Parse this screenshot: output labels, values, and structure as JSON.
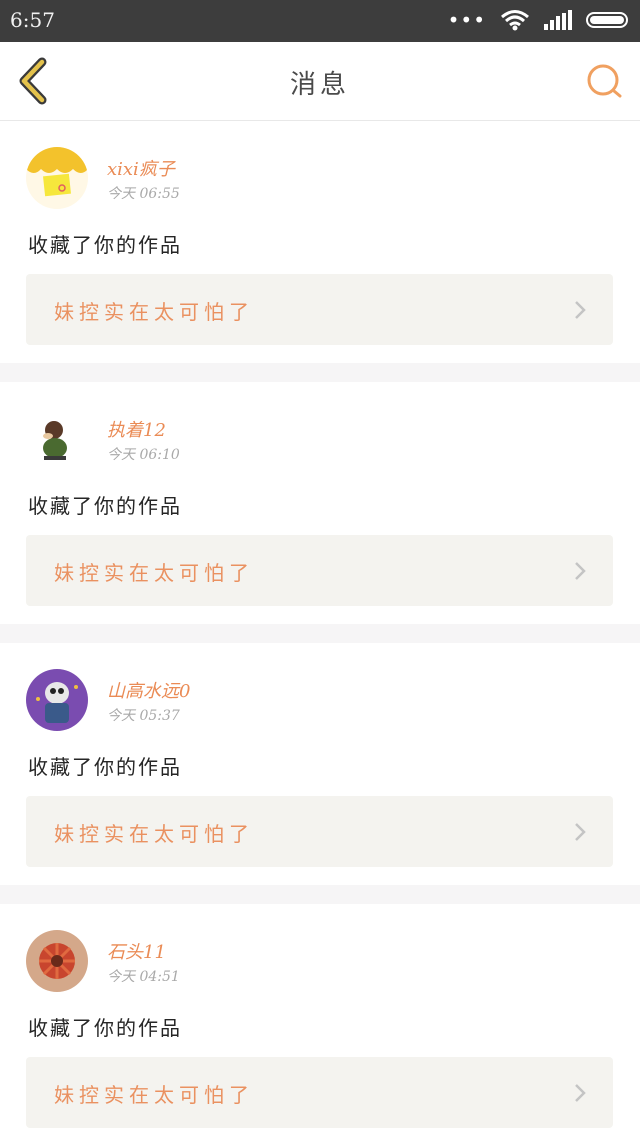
{
  "status_bar": {
    "time": "6:57",
    "dots": "•••"
  },
  "header": {
    "title": "消息"
  },
  "messages": [
    {
      "user": "xixi疯子",
      "time": "今天 06:55",
      "action": "收藏了你的作品",
      "work_title": "妹控实在太可怕了"
    },
    {
      "user": "执着12",
      "time": "今天 06:10",
      "action": "收藏了你的作品",
      "work_title": "妹控实在太可怕了"
    },
    {
      "user": "山高水远0",
      "time": "今天 05:37",
      "action": "收藏了你的作品",
      "work_title": "妹控实在太可怕了"
    },
    {
      "user": "石头11",
      "time": "今天 04:51",
      "action": "收藏了你的作品",
      "work_title": "妹控实在太可怕了"
    }
  ],
  "colors": {
    "accent": "#ea8b55",
    "back_icon": "#d9b33a",
    "status_bar": "#3d3d3d",
    "card_box": "#f4f3ef"
  },
  "icons": [
    "back-arrow-icon",
    "search-icon",
    "wifi-icon",
    "signal-icon",
    "battery-icon",
    "chevron-right-icon"
  ]
}
